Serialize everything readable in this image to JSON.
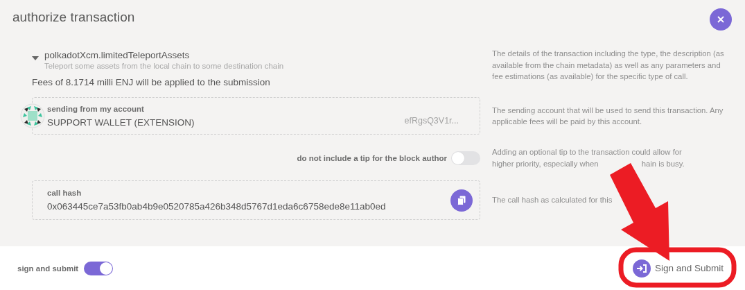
{
  "window": {
    "title": "authorize transaction"
  },
  "call": {
    "method": "polkadotXcm.limitedTeleportAssets",
    "description": "Teleport some assets from the local chain to some destination chain",
    "expanded": true,
    "fees": "Fees of 8.1714 milli ENJ will be applied to the submission",
    "help": "The details of the transaction including the type, the description (as available from the chain metadata) as well as any parameters and fee estimations (as available) for the specific type of call."
  },
  "account": {
    "label": "sending from my account",
    "name": "SUPPORT WALLET (EXTENSION)",
    "address": "efRgsQ3V1r...",
    "help": "The sending account that will be used to send this transaction. Any applicable fees will be paid by this account."
  },
  "tip": {
    "label": "do not include a tip for the block author",
    "on": false,
    "help_line_1": "Adding an optional tip to the transaction could allow for",
    "help_line_2": "higher priority, especially when",
    "help_line_2_tail": "hain is busy."
  },
  "call_hash": {
    "label": "call hash",
    "value": "0x063445ce7a53fb0ab4b9e0520785a426b348d5767d1eda6c6758ede8e11ab0ed",
    "help": "The call hash as calculated for this"
  },
  "footer": {
    "toggle": {
      "label": "sign and submit",
      "on": true
    },
    "button": "Sign and Submit"
  }
}
